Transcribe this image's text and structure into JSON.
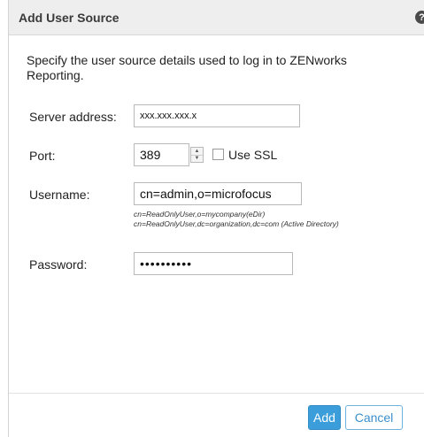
{
  "dialog": {
    "title": "Add User Source",
    "help_icon": "?",
    "description": "Specify the user source details used to log in to ZENworks Reporting."
  },
  "form": {
    "server_address": {
      "label": "Server address:",
      "value": "xxx.xxx.xxx.x"
    },
    "port": {
      "label": "Port:",
      "value": "389",
      "use_ssl_label": "Use SSL",
      "use_ssl_checked": false
    },
    "username": {
      "label": "Username:",
      "value": "cn=admin,o=microfocus",
      "hint_line1": "cn=ReadOnlyUser,o=mycompany(eDir)",
      "hint_line2": "cn=ReadOnlyUser,dc=organization,dc=com (Active Directory)"
    },
    "password": {
      "label": "Password:",
      "value": "••••••••••"
    }
  },
  "buttons": {
    "add": "Add",
    "cancel": "Cancel"
  },
  "colors": {
    "accent": "#3b9edb",
    "titlebar": "#eeeeee"
  },
  "icons": {
    "help": "help-icon",
    "spinner_up": "spinner-up-icon",
    "spinner_down": "spinner-down-icon"
  }
}
